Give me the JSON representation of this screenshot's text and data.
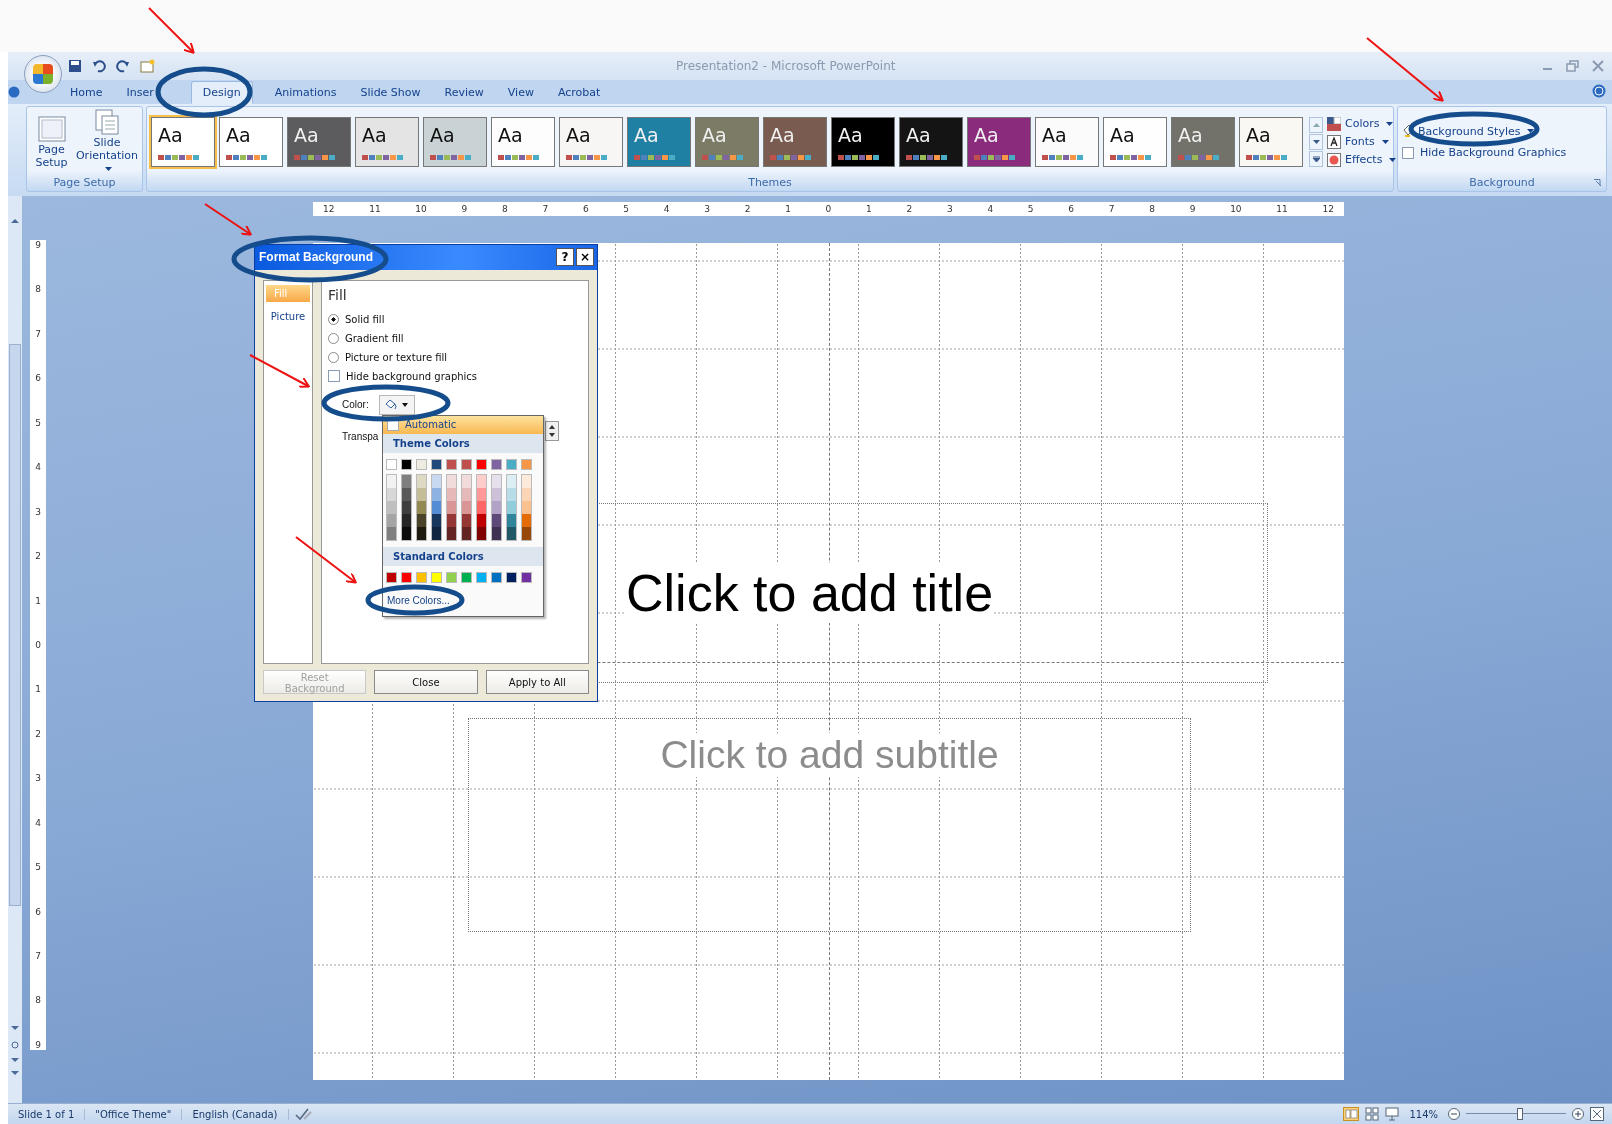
{
  "window": {
    "title": "Presentation2 - Microsoft PowerPoint"
  },
  "tabs": [
    {
      "label": "Home",
      "selected": false
    },
    {
      "label": "Inser",
      "selected": false
    },
    {
      "label": "Design",
      "selected": true
    },
    {
      "label": "Animations",
      "selected": false
    },
    {
      "label": "Slide Show",
      "selected": false
    },
    {
      "label": "Review",
      "selected": false
    },
    {
      "label": "View",
      "selected": false
    },
    {
      "label": "Acrobat",
      "selected": false
    }
  ],
  "ribbon": {
    "page_setup": {
      "buttons": [
        "Page Setup",
        "Slide Orientation"
      ],
      "label": "Page Setup"
    },
    "themes": {
      "label": "Themes",
      "items": [
        {
          "label": "Aa",
          "color": "#ffffff",
          "selected": true
        },
        {
          "label": "Aa",
          "color": "#ffffff",
          "selected": false
        },
        {
          "label": "Aa",
          "color": "#5c5c5e",
          "selected": false
        },
        {
          "label": "Aa",
          "color": "#e4e4e4",
          "selected": false
        },
        {
          "label": "Aa",
          "color": "#c9d2d4",
          "selected": false
        },
        {
          "label": "Aa",
          "color": "#fdfdfd",
          "selected": false
        },
        {
          "label": "Aa",
          "color": "#f8f6f4",
          "selected": false
        },
        {
          "label": "Aa",
          "color": "#1f80a4",
          "selected": false
        },
        {
          "label": "Aa",
          "color": "#7b7b66",
          "selected": false
        },
        {
          "label": "Aa",
          "color": "#7a5b4f",
          "selected": false
        },
        {
          "label": "Aa",
          "color": "#000000",
          "selected": false
        },
        {
          "label": "Aa",
          "color": "#141414",
          "selected": false
        },
        {
          "label": "Aa",
          "color": "#8b2b7c",
          "selected": false
        },
        {
          "label": "Aa",
          "color": "#fbfbfb",
          "selected": false
        },
        {
          "label": "Aa",
          "color": "#fefefe",
          "selected": false
        },
        {
          "label": "Aa",
          "color": "#72726a",
          "selected": false
        },
        {
          "label": "Aa",
          "color": "#faf8f2",
          "selected": false
        }
      ],
      "options": [
        "Colors",
        "Fonts",
        "Effects"
      ]
    },
    "background": {
      "styles_button": "Background Styles",
      "hide_graphics": {
        "label": "Hide Background Graphics",
        "checked": false
      },
      "label": "Background"
    }
  },
  "ruler": {
    "horizontal": [
      "12",
      "11",
      "10",
      "9",
      "8",
      "7",
      "6",
      "5",
      "4",
      "3",
      "2",
      "1",
      "0",
      "1",
      "2",
      "3",
      "4",
      "5",
      "6",
      "7",
      "8",
      "9",
      "10",
      "11",
      "12"
    ],
    "vertical": [
      "9",
      "8",
      "7",
      "6",
      "5",
      "4",
      "3",
      "2",
      "1",
      "0",
      "1",
      "2",
      "3",
      "4",
      "5",
      "6",
      "7",
      "8",
      "9"
    ]
  },
  "slide": {
    "title_placeholder": "Click to add title",
    "subtitle_placeholder": "Click to add subtitle"
  },
  "dialog": {
    "title": "Format Background",
    "help": "?",
    "close": "×",
    "nav": [
      {
        "label": "Fill",
        "selected": true
      },
      {
        "label": "Picture",
        "selected": false
      }
    ],
    "heading": "Fill",
    "fill_options": [
      {
        "label": "Solid fill",
        "selected": true
      },
      {
        "label": "Gradient fill",
        "selected": false
      },
      {
        "label": "Picture or texture fill",
        "selected": false
      }
    ],
    "hide_graphics": {
      "label": "Hide background graphics",
      "checked": false
    },
    "color_label": "Color:",
    "transparency_label": "Transpa",
    "color_menu": {
      "automatic": "Automatic",
      "theme_heading": "Theme Colors",
      "theme_colors": [
        {
          "color": "#ffffff",
          "shades": [
            {
              "color": "#f2f2f2"
            },
            {
              "color": "#d8d8d8"
            },
            {
              "color": "#bfbfbf"
            },
            {
              "color": "#a5a5a5"
            },
            {
              "color": "#7f7f7f"
            }
          ]
        },
        {
          "color": "#000000",
          "shades": [
            {
              "color": "#7f7f7f"
            },
            {
              "color": "#595959"
            },
            {
              "color": "#3f3f3f"
            },
            {
              "color": "#262626"
            },
            {
              "color": "#0c0c0c"
            }
          ]
        },
        {
          "color": "#eeece1",
          "shades": [
            {
              "color": "#ddd9c3"
            },
            {
              "color": "#c4bd97"
            },
            {
              "color": "#938953"
            },
            {
              "color": "#494429"
            },
            {
              "color": "#1d1b10"
            }
          ]
        },
        {
          "color": "#1f497d",
          "shades": [
            {
              "color": "#c6d9f0"
            },
            {
              "color": "#8db3e2"
            },
            {
              "color": "#548dd4"
            },
            {
              "color": "#17365d"
            },
            {
              "color": "#0f243e"
            }
          ]
        },
        {
          "color": "#c0504d",
          "shades": [
            {
              "color": "#f2dcdb"
            },
            {
              "color": "#e5b9b7"
            },
            {
              "color": "#d99694"
            },
            {
              "color": "#953734"
            },
            {
              "color": "#632423"
            }
          ]
        },
        {
          "color": "#c0504d",
          "shades": [
            {
              "color": "#f2dcdb"
            },
            {
              "color": "#e5b9b7"
            },
            {
              "color": "#d99694"
            },
            {
              "color": "#953734"
            },
            {
              "color": "#632423"
            }
          ]
        },
        {
          "color": "#ff0000",
          "shades": [
            {
              "color": "#ffcccc"
            },
            {
              "color": "#ff9999"
            },
            {
              "color": "#ff6666"
            },
            {
              "color": "#c00000"
            },
            {
              "color": "#800000"
            }
          ]
        },
        {
          "color": "#8064a2",
          "shades": [
            {
              "color": "#e5e0ec"
            },
            {
              "color": "#ccc1d9"
            },
            {
              "color": "#b2a2c7"
            },
            {
              "color": "#5f497a"
            },
            {
              "color": "#3f3151"
            }
          ]
        },
        {
          "color": "#4bacc6",
          "shades": [
            {
              "color": "#dbeef3"
            },
            {
              "color": "#b7dde8"
            },
            {
              "color": "#92cddc"
            },
            {
              "color": "#31859b"
            },
            {
              "color": "#205867"
            }
          ]
        },
        {
          "color": "#f79646",
          "shades": [
            {
              "color": "#fdeada"
            },
            {
              "color": "#fbd5b5"
            },
            {
              "color": "#fac08f"
            },
            {
              "color": "#e36c09"
            },
            {
              "color": "#974806"
            }
          ]
        }
      ],
      "standard_heading": "Standard Colors",
      "standard_colors": [
        {
          "color": "#c00000"
        },
        {
          "color": "#ff0000"
        },
        {
          "color": "#ffc000"
        },
        {
          "color": "#ffff00"
        },
        {
          "color": "#92d050"
        },
        {
          "color": "#00b050"
        },
        {
          "color": "#00b0f0"
        },
        {
          "color": "#0070c0"
        },
        {
          "color": "#002060"
        },
        {
          "color": "#7030a0"
        }
      ],
      "more": "More Colors..."
    },
    "buttons": [
      {
        "label": "Reset Background",
        "disabled": true
      },
      {
        "label": "Close",
        "disabled": false
      },
      {
        "label": "Apply to All",
        "disabled": false
      }
    ]
  },
  "status_bar": {
    "items": [
      "Slide 1 of 1",
      "\"Office Theme\"",
      "English (Canada)"
    ],
    "zoom": "114%",
    "zoom_slider": {
      "level": 0.55
    }
  }
}
